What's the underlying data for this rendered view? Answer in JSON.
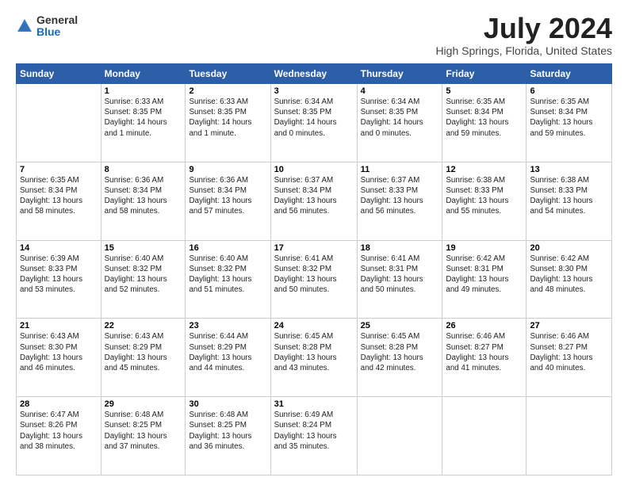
{
  "header": {
    "logo_line1": "General",
    "logo_line2": "Blue",
    "month_title": "July 2024",
    "location": "High Springs, Florida, United States"
  },
  "weekdays": [
    "Sunday",
    "Monday",
    "Tuesday",
    "Wednesday",
    "Thursday",
    "Friday",
    "Saturday"
  ],
  "weeks": [
    [
      {
        "day": "",
        "info": ""
      },
      {
        "day": "1",
        "info": "Sunrise: 6:33 AM\nSunset: 8:35 PM\nDaylight: 14 hours\nand 1 minute."
      },
      {
        "day": "2",
        "info": "Sunrise: 6:33 AM\nSunset: 8:35 PM\nDaylight: 14 hours\nand 1 minute."
      },
      {
        "day": "3",
        "info": "Sunrise: 6:34 AM\nSunset: 8:35 PM\nDaylight: 14 hours\nand 0 minutes."
      },
      {
        "day": "4",
        "info": "Sunrise: 6:34 AM\nSunset: 8:35 PM\nDaylight: 14 hours\nand 0 minutes."
      },
      {
        "day": "5",
        "info": "Sunrise: 6:35 AM\nSunset: 8:34 PM\nDaylight: 13 hours\nand 59 minutes."
      },
      {
        "day": "6",
        "info": "Sunrise: 6:35 AM\nSunset: 8:34 PM\nDaylight: 13 hours\nand 59 minutes."
      }
    ],
    [
      {
        "day": "7",
        "info": "Sunrise: 6:35 AM\nSunset: 8:34 PM\nDaylight: 13 hours\nand 58 minutes."
      },
      {
        "day": "8",
        "info": "Sunrise: 6:36 AM\nSunset: 8:34 PM\nDaylight: 13 hours\nand 58 minutes."
      },
      {
        "day": "9",
        "info": "Sunrise: 6:36 AM\nSunset: 8:34 PM\nDaylight: 13 hours\nand 57 minutes."
      },
      {
        "day": "10",
        "info": "Sunrise: 6:37 AM\nSunset: 8:34 PM\nDaylight: 13 hours\nand 56 minutes."
      },
      {
        "day": "11",
        "info": "Sunrise: 6:37 AM\nSunset: 8:33 PM\nDaylight: 13 hours\nand 56 minutes."
      },
      {
        "day": "12",
        "info": "Sunrise: 6:38 AM\nSunset: 8:33 PM\nDaylight: 13 hours\nand 55 minutes."
      },
      {
        "day": "13",
        "info": "Sunrise: 6:38 AM\nSunset: 8:33 PM\nDaylight: 13 hours\nand 54 minutes."
      }
    ],
    [
      {
        "day": "14",
        "info": "Sunrise: 6:39 AM\nSunset: 8:33 PM\nDaylight: 13 hours\nand 53 minutes."
      },
      {
        "day": "15",
        "info": "Sunrise: 6:40 AM\nSunset: 8:32 PM\nDaylight: 13 hours\nand 52 minutes."
      },
      {
        "day": "16",
        "info": "Sunrise: 6:40 AM\nSunset: 8:32 PM\nDaylight: 13 hours\nand 51 minutes."
      },
      {
        "day": "17",
        "info": "Sunrise: 6:41 AM\nSunset: 8:32 PM\nDaylight: 13 hours\nand 50 minutes."
      },
      {
        "day": "18",
        "info": "Sunrise: 6:41 AM\nSunset: 8:31 PM\nDaylight: 13 hours\nand 50 minutes."
      },
      {
        "day": "19",
        "info": "Sunrise: 6:42 AM\nSunset: 8:31 PM\nDaylight: 13 hours\nand 49 minutes."
      },
      {
        "day": "20",
        "info": "Sunrise: 6:42 AM\nSunset: 8:30 PM\nDaylight: 13 hours\nand 48 minutes."
      }
    ],
    [
      {
        "day": "21",
        "info": "Sunrise: 6:43 AM\nSunset: 8:30 PM\nDaylight: 13 hours\nand 46 minutes."
      },
      {
        "day": "22",
        "info": "Sunrise: 6:43 AM\nSunset: 8:29 PM\nDaylight: 13 hours\nand 45 minutes."
      },
      {
        "day": "23",
        "info": "Sunrise: 6:44 AM\nSunset: 8:29 PM\nDaylight: 13 hours\nand 44 minutes."
      },
      {
        "day": "24",
        "info": "Sunrise: 6:45 AM\nSunset: 8:28 PM\nDaylight: 13 hours\nand 43 minutes."
      },
      {
        "day": "25",
        "info": "Sunrise: 6:45 AM\nSunset: 8:28 PM\nDaylight: 13 hours\nand 42 minutes."
      },
      {
        "day": "26",
        "info": "Sunrise: 6:46 AM\nSunset: 8:27 PM\nDaylight: 13 hours\nand 41 minutes."
      },
      {
        "day": "27",
        "info": "Sunrise: 6:46 AM\nSunset: 8:27 PM\nDaylight: 13 hours\nand 40 minutes."
      }
    ],
    [
      {
        "day": "28",
        "info": "Sunrise: 6:47 AM\nSunset: 8:26 PM\nDaylight: 13 hours\nand 38 minutes."
      },
      {
        "day": "29",
        "info": "Sunrise: 6:48 AM\nSunset: 8:25 PM\nDaylight: 13 hours\nand 37 minutes."
      },
      {
        "day": "30",
        "info": "Sunrise: 6:48 AM\nSunset: 8:25 PM\nDaylight: 13 hours\nand 36 minutes."
      },
      {
        "day": "31",
        "info": "Sunrise: 6:49 AM\nSunset: 8:24 PM\nDaylight: 13 hours\nand 35 minutes."
      },
      {
        "day": "",
        "info": ""
      },
      {
        "day": "",
        "info": ""
      },
      {
        "day": "",
        "info": ""
      }
    ]
  ]
}
